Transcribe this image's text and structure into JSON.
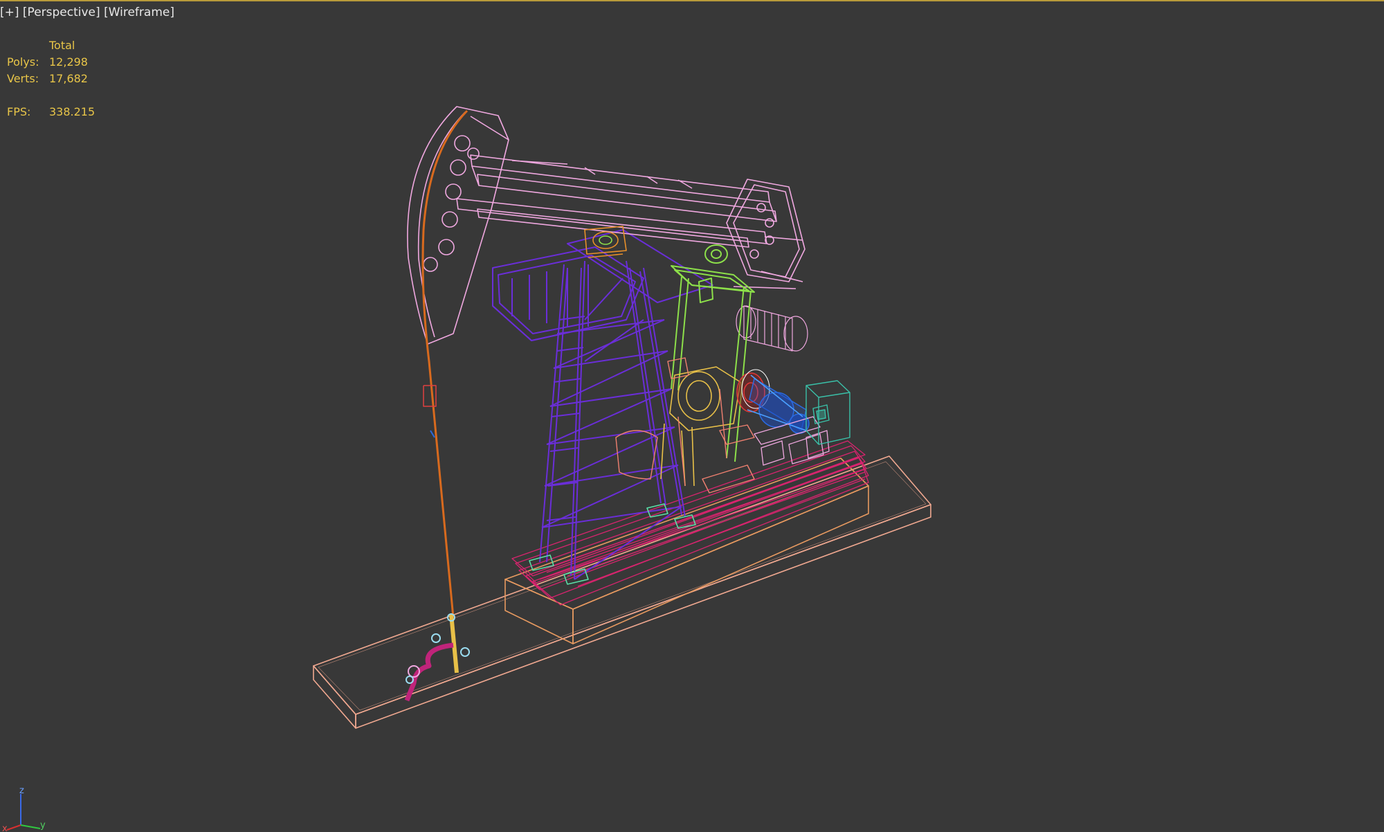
{
  "viewport": {
    "label_plus": "[+]",
    "label_view": "[Perspective]",
    "label_mode": "[Wireframe]"
  },
  "stats": {
    "header": "Total",
    "polys_label": "Polys:",
    "polys_value": "12,298",
    "verts_label": "Verts:",
    "verts_value": "17,682",
    "fps_label": "FPS:",
    "fps_value": "338.215"
  },
  "axis_gizmo": {
    "z": "z",
    "x": "x",
    "y": "y"
  },
  "colors": {
    "background": "#383838",
    "stats_text": "#e8c548",
    "walking_beam": "#f0a8e0",
    "samson_post": "#6a2ed8",
    "pitman_arm": "#8de04a",
    "base_skid": "#d8246e",
    "foundation": "#f0a890",
    "polished_rod": "#d86a1e",
    "motor": "#2a6ae0",
    "control_box": "#3ac0a8",
    "gearbox": "#e8c048",
    "wellhead": "#c0247a"
  }
}
